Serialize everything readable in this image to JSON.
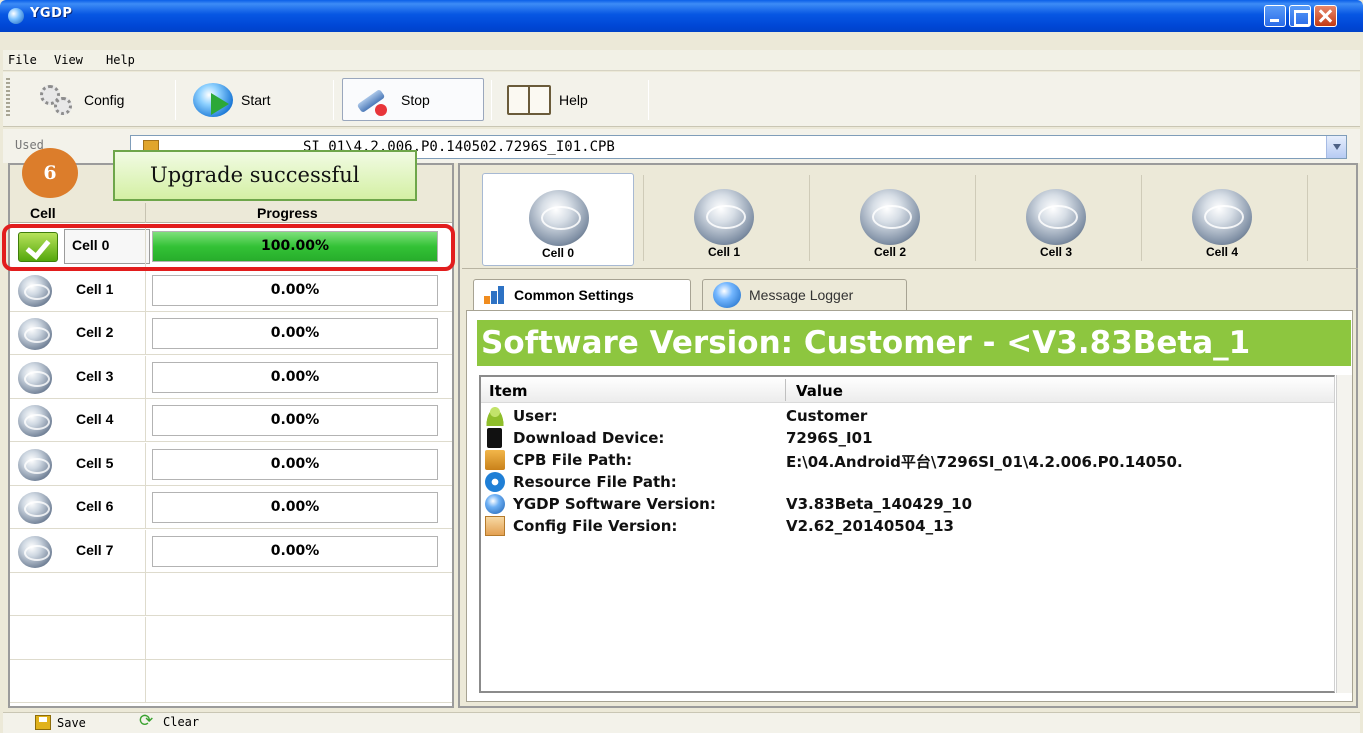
{
  "window": {
    "title": "YGDP"
  },
  "menu": [
    {
      "label": "File"
    },
    {
      "label": "View"
    },
    {
      "label": "Help"
    }
  ],
  "toolbar": {
    "config_label": "Config",
    "start_label": "Start",
    "stop_label": "Stop",
    "help_label": "Help"
  },
  "address": {
    "label": "Used",
    "value": "SI_01\\4.2.006.P0.140502.7296S_I01.CPB"
  },
  "callout": {
    "number": "6",
    "text": "Upgrade successful"
  },
  "cell_table": {
    "col_cell": "Cell",
    "col_progress": "Progress",
    "rows": [
      {
        "label": "Cell 0",
        "progress_text": "100.00%",
        "progress_value": 100,
        "status": "done"
      },
      {
        "label": "Cell 1",
        "progress_text": "0.00%",
        "progress_value": 0,
        "status": "idle"
      },
      {
        "label": "Cell 2",
        "progress_text": "0.00%",
        "progress_value": 0,
        "status": "idle"
      },
      {
        "label": "Cell 3",
        "progress_text": "0.00%",
        "progress_value": 0,
        "status": "idle"
      },
      {
        "label": "Cell 4",
        "progress_text": "0.00%",
        "progress_value": 0,
        "status": "idle"
      },
      {
        "label": "Cell 5",
        "progress_text": "0.00%",
        "progress_value": 0,
        "status": "idle"
      },
      {
        "label": "Cell 6",
        "progress_text": "0.00%",
        "progress_value": 0,
        "status": "idle"
      },
      {
        "label": "Cell 7",
        "progress_text": "0.00%",
        "progress_value": 0,
        "status": "idle"
      }
    ]
  },
  "cell_tabs": [
    {
      "label": "Cell 0",
      "selected": true
    },
    {
      "label": "Cell 1",
      "selected": false
    },
    {
      "label": "Cell 2",
      "selected": false
    },
    {
      "label": "Cell 3",
      "selected": false
    },
    {
      "label": "Cell 4",
      "selected": false
    }
  ],
  "sub_tabs": {
    "common": "Common Settings",
    "logger": "Message Logger"
  },
  "version_banner": "Software Version:  Customer - <V3.83Beta_1",
  "properties": {
    "col_item": "Item",
    "col_value": "Value",
    "rows": [
      {
        "icon": "user-icon",
        "item": "User:",
        "value": "Customer"
      },
      {
        "icon": "device-icon",
        "item": "Download Device:",
        "value": "7296S_I01"
      },
      {
        "icon": "file-icon",
        "item": "CPB File Path:",
        "value": "E:\\04.Android平台\\7296SI_01\\4.2.006.P0.14050."
      },
      {
        "icon": "resource-icon",
        "item": "Resource File Path:",
        "value": ""
      },
      {
        "icon": "globe-icon",
        "item": "YGDP Software Version:",
        "value": "V3.83Beta_140429_10"
      },
      {
        "icon": "config-icon",
        "item": "Config File Version:",
        "value": "V2.62_20140504_13"
      }
    ]
  },
  "bottom_toolbar": {
    "save_label": "Save",
    "clear_label": "Clear"
  },
  "colors": {
    "title_bar": "#0757e3",
    "progress_fill": "#33c236",
    "version_banner_bg": "#8dc63f",
    "highlight": "#e21d1d",
    "callout_badge": "#dc7d2b",
    "callout_box": "#d4f0a4"
  }
}
